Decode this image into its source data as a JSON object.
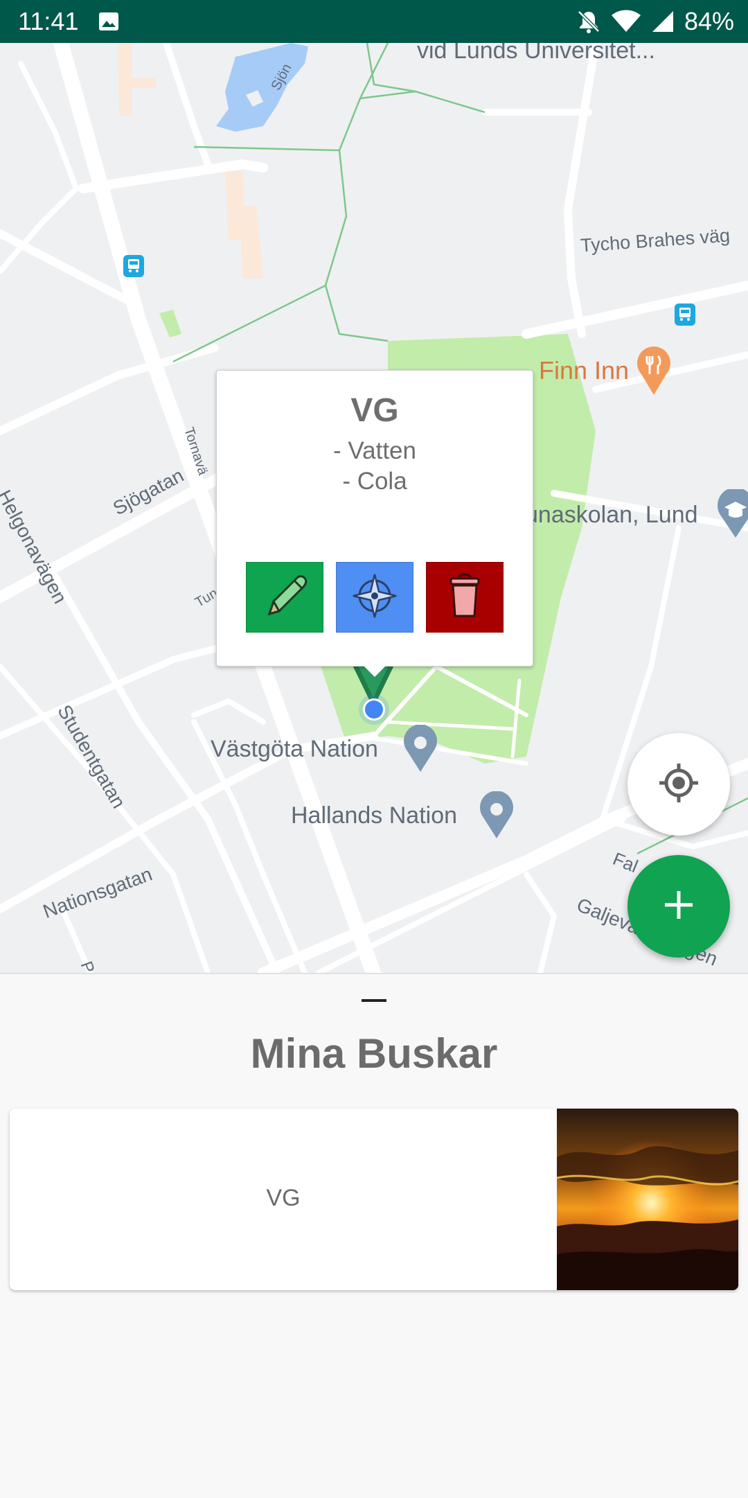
{
  "status_bar": {
    "time": "11:41",
    "battery": "84%"
  },
  "map": {
    "labels": {
      "univ": "vid Lunds Universitet...",
      "sjon": "Sjön",
      "tycho": "Tycho Brahes väg",
      "helgona": "Helgonavägen",
      "sjogatan": "Sjögatan",
      "tornav": "Tornavä",
      "tunav": "Tun",
      "student": "Studentgatan",
      "nations": "Nationsgatan",
      "gald": "Galjevångsvägen",
      "fal": "Fal",
      "p": "P"
    },
    "pois": {
      "finn": "Finn Inn",
      "skolan": "unaskolan, Lund",
      "vastgota": "Västgöta Nation",
      "hallands": "Hallands Nation"
    },
    "infowindow": {
      "title": "VG",
      "items": [
        "- Vatten",
        "- Cola"
      ]
    }
  },
  "sheet": {
    "title": "Mina Buskar",
    "cards": [
      {
        "name": "VG"
      }
    ]
  },
  "colors": {
    "status_bar": "#00584a",
    "accent_green": "#10a351",
    "edit_green": "#0fa44f",
    "nav_blue": "#4f8ef2",
    "delete_red": "#a80000"
  },
  "icons": [
    "image-icon",
    "mute-icon",
    "wifi-icon",
    "signal-icon",
    "bus-stop-icon",
    "restaurant-icon",
    "school-icon",
    "place-icon",
    "pencil-icon",
    "compass-icon",
    "trash-icon",
    "my-location-icon",
    "plus-icon",
    "marker-icon"
  ]
}
